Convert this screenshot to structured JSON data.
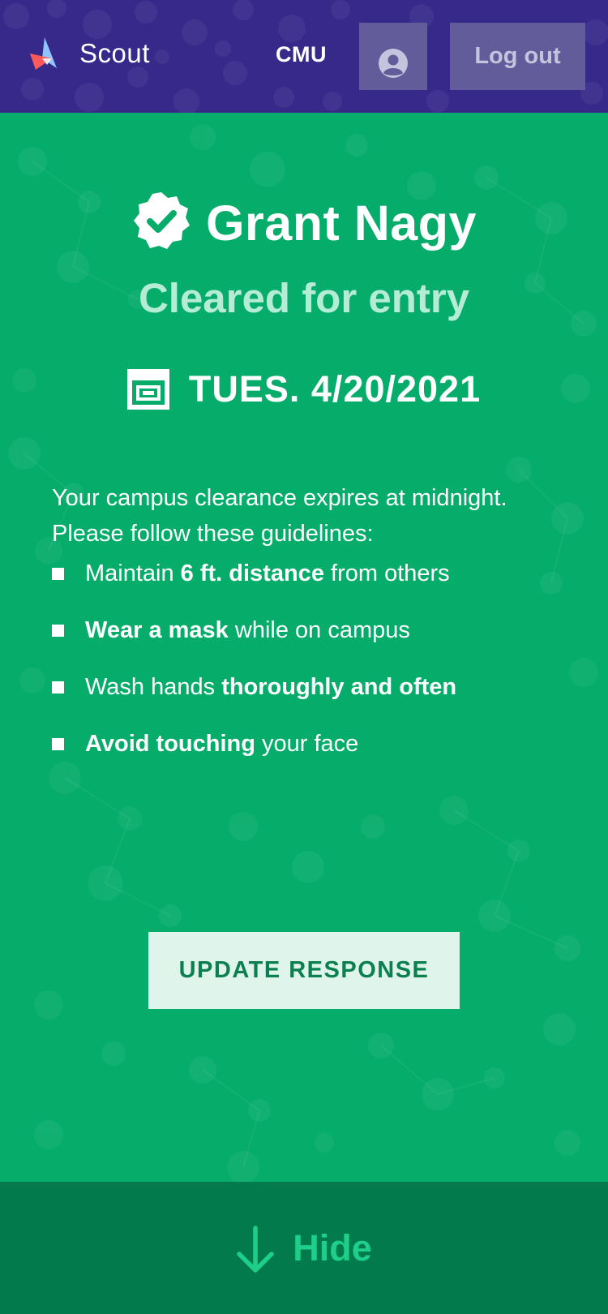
{
  "header": {
    "app_name": "Scout",
    "org": "CMU",
    "profile_icon": "user-avatar-icon",
    "logout_label": "Log out",
    "background_color": "#37298a"
  },
  "pass": {
    "verified_icon": "verified-badge-icon",
    "name": "Grant Nagy",
    "status": "Cleared for entry",
    "calendar_icon": "calendar-icon",
    "date": "TUES. 4/20/2021",
    "intro": "Your campus clearance expires at midnight. Please follow these guidelines:",
    "guidelines": [
      {
        "pre": "Maintain ",
        "bold": "6 ft. distance",
        "post": " from others"
      },
      {
        "pre": "",
        "bold": "Wear a mask",
        "post": " while on campus"
      },
      {
        "pre": "Wash hands ",
        "bold": "thoroughly and often",
        "post": ""
      },
      {
        "pre": "",
        "bold": "Avoid touching",
        "post": " your face"
      }
    ],
    "update_label": "UPDATE RESPONSE",
    "background_color": "#05ac6a"
  },
  "footer": {
    "arrow_icon": "arrow-down-icon",
    "hide_label": "Hide",
    "background_color": "#027a4c"
  }
}
